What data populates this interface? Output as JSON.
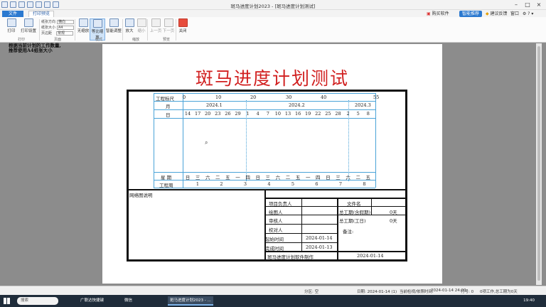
{
  "window": {
    "title": "斑马进度计划2023 - [斑马进度计划测试]"
  },
  "ribbon": {
    "tab_file": "文件",
    "tab_preview": "打印预览",
    "right": {
      "account": "购买软件",
      "smart": "智能推荐",
      "feedback": "建议反馈",
      "window": "窗口"
    },
    "buttons": {
      "print": "打印",
      "print_setup": "打印设置",
      "no_zoom": "无缩放",
      "fit_width": "等比缩放",
      "smart_zoom": "智能调整",
      "zoom_in": "放大",
      "zoom_out": "缩小",
      "prev": "上一页",
      "next": "下一页",
      "close": "关闭"
    },
    "fields": {
      "orientation_label": "纸张方向",
      "orientation_value": "横向",
      "size_label": "纸张大小",
      "size_value": "A4",
      "margin_label": "页边距",
      "margin_value": "常规"
    },
    "groups": {
      "print": "打印",
      "page": "页面",
      "mode": "模式",
      "zoom": "缩放",
      "preview": "预览"
    }
  },
  "left_note": "根据当前计划的工作数量,\n推荐使用A4纸张大小",
  "document": {
    "title": "斑马进度计划测试",
    "ruler_label": "工程标尺",
    "ruler_ticks": [
      "0",
      "10",
      "20",
      "30",
      "40",
      "55"
    ],
    "month_label": "月",
    "months": [
      "2024.1",
      "2024.2",
      "2024.3"
    ],
    "day_label": "日",
    "days": [
      "14",
      "17",
      "20",
      "23",
      "26",
      "29",
      "1",
      "4",
      "7",
      "10",
      "13",
      "16",
      "19",
      "22",
      "25",
      "28",
      "2",
      "5",
      "8"
    ],
    "week_label": "星  期",
    "weekdays": [
      "日",
      "三",
      "六",
      "二",
      "五",
      "一",
      "四",
      "日",
      "三",
      "六",
      "二",
      "五",
      "一",
      "四",
      "日",
      "三",
      "六",
      "二",
      "五"
    ],
    "week_no_label": "工程周",
    "week_numbers": [
      "1",
      "2",
      "3",
      "4",
      "5",
      "6",
      "7",
      "8"
    ],
    "network_note": "网络图说明",
    "info": {
      "manager": "项目负责人",
      "file_name": "文件名",
      "drafter": "绘图人",
      "total_duration_label": "总工期(含假期)",
      "total_duration": "0天",
      "reviewer": "审核人",
      "work_duration_label": "总工期(工日)",
      "work_duration": "0天",
      "checker": "校对人",
      "remark": "备注:",
      "start_label": "起始时间",
      "start": "2024-01-14",
      "end_label": "完成时间",
      "end": "2024-01-13",
      "maker": "斑马进度计划软件制作",
      "made_date": "2024-01-14"
    }
  },
  "status": {
    "partition": "分区: 空",
    "date": "日期: 2024-01-14 (1)",
    "current": "当前检视/依照时间:",
    "current_value": "2024-01-14 24:00",
    "row": "行号: 0",
    "work": "0项工作,总工期为0天"
  },
  "taskbar": {
    "search": "搜索",
    "apps": [
      "广联达快捷键",
      "微信",
      "斑马进度计划2023 - ..."
    ],
    "clock": "19:40"
  }
}
